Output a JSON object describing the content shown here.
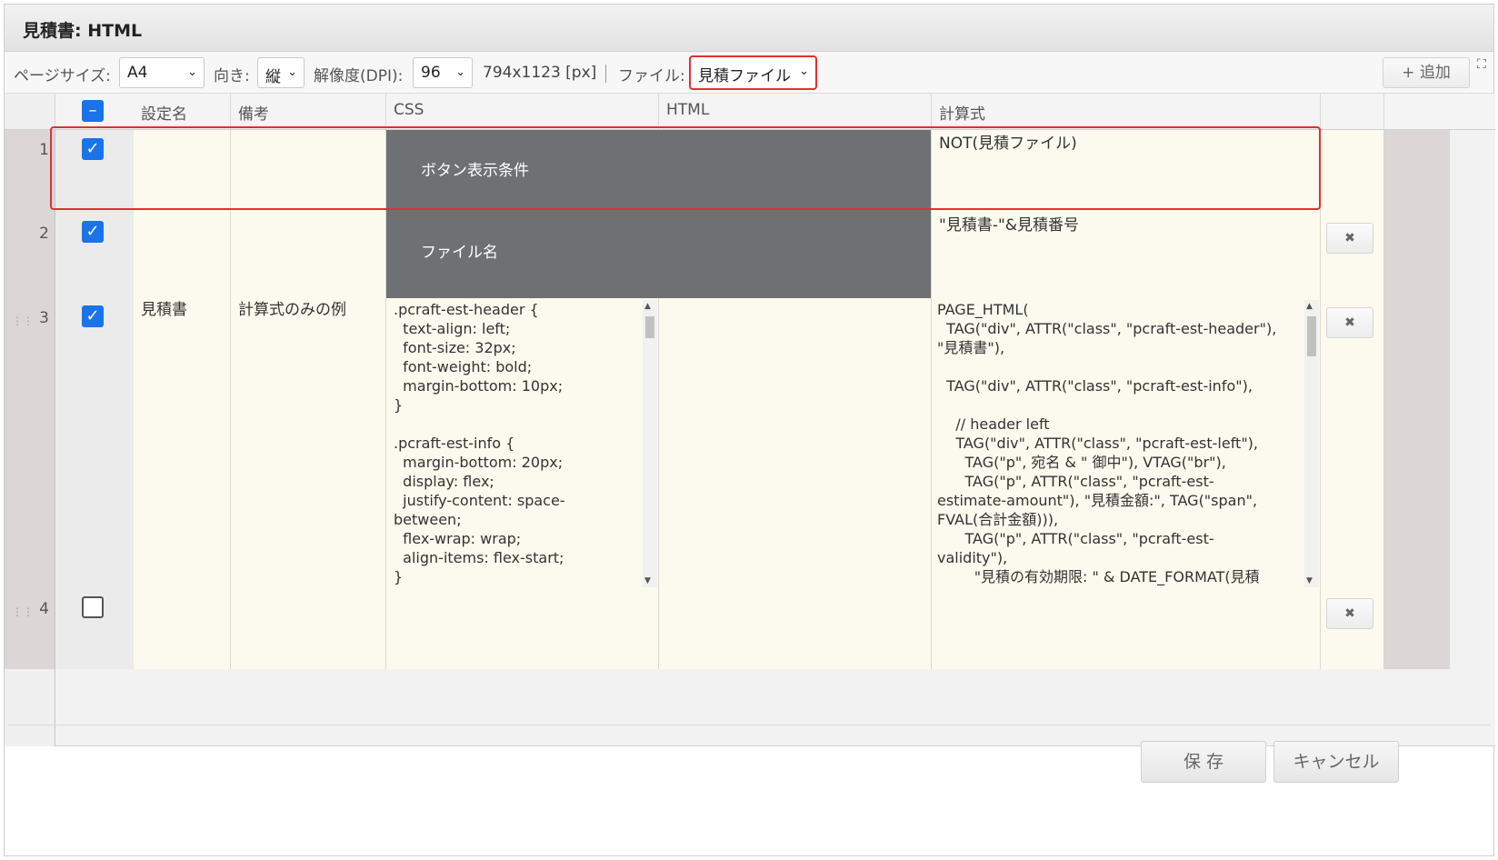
{
  "window": {
    "title": "見積書: HTML"
  },
  "toolbar": {
    "page_size_label": "ページサイズ:",
    "page_size_value": "A4",
    "orientation_label": "向き:",
    "orientation_value": "縦",
    "dpi_label": "解像度(DPI):",
    "dpi_value": "96",
    "dimensions": "794x1123 [px]",
    "file_label": "ファイル:",
    "file_value": "見積ファイル",
    "add_label": "+ 追加"
  },
  "table": {
    "columns": [
      "設定名",
      "備考",
      "CSS",
      "HTML",
      "計算式"
    ],
    "rows": [
      {
        "num": "1",
        "checked": true,
        "name": "",
        "note": "",
        "css": "",
        "html": "ボタン表示条件",
        "formula": "NOT(見積ファイル)"
      },
      {
        "num": "2",
        "checked": true,
        "name": "",
        "note": "",
        "css": "",
        "html": "ファイル名",
        "formula": "\"見積書-\"&見積番号"
      },
      {
        "num": "3",
        "checked": true,
        "name": "見積書",
        "note": "計算式のみの例",
        "css": ".pcraft-est-header {\n  text-align: left;\n  font-size: 32px;\n  font-weight: bold;\n  margin-bottom: 10px;\n}\n\n.pcraft-est-info {\n  margin-bottom: 20px;\n  display: flex;\n  justify-content: space-\nbetween;\n  flex-wrap: wrap;\n  align-items: flex-start;\n}",
        "html": "",
        "formula": "PAGE_HTML(\n  TAG(\"div\", ATTR(\"class\", \"pcraft-est-header\"),\n\"見積書\"),\n\n  TAG(\"div\", ATTR(\"class\", \"pcraft-est-info\"),\n\n    // header left\n    TAG(\"div\", ATTR(\"class\", \"pcraft-est-left\"),\n      TAG(\"p\", 宛名 & \" 御中\"), VTAG(\"br\"),\n      TAG(\"p\", ATTR(\"class\", \"pcraft-est-\nestimate-amount\"), \"見積金額:\", TAG(\"span\",\nFVAL(合計金額))),\n      TAG(\"p\", ATTR(\"class\", \"pcraft-est-\nvalidity\"),\n        \"見積の有効期限: \" & DATE_FORMAT(見積"
      },
      {
        "num": "4",
        "checked": false,
        "name": "",
        "note": "",
        "css": "",
        "html": "",
        "formula": ""
      }
    ]
  },
  "footer": {
    "save_label": "保 存",
    "cancel_label": "キャンセル"
  }
}
